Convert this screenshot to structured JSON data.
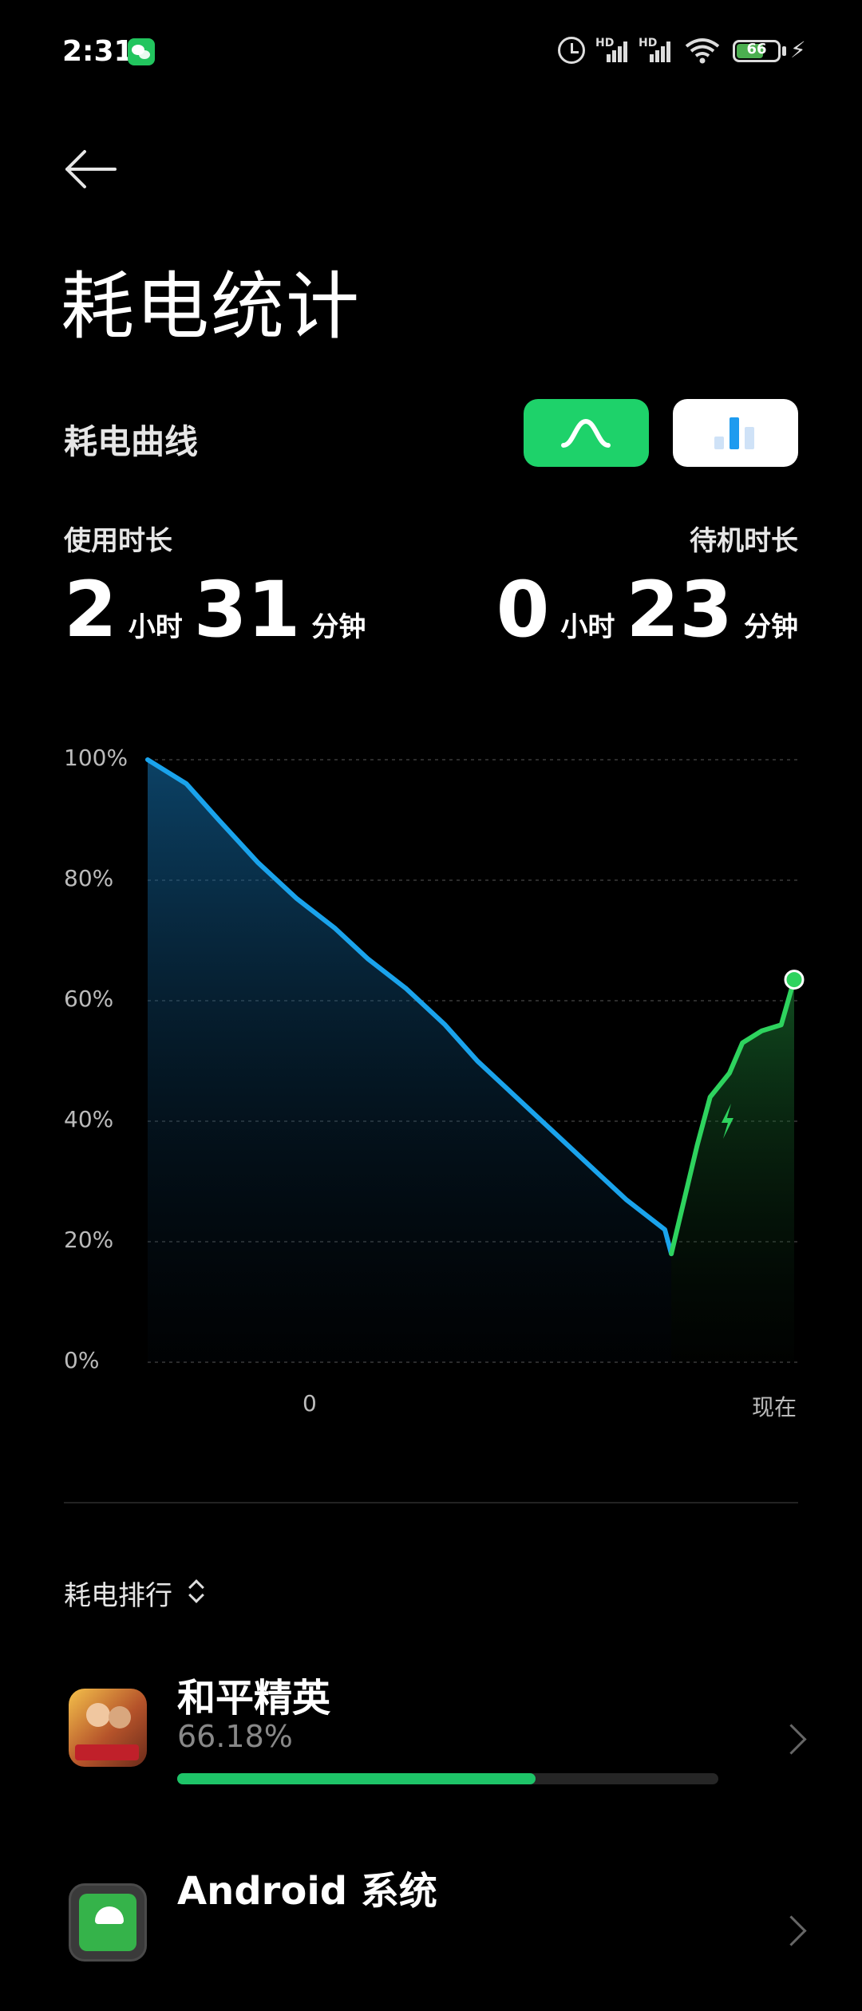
{
  "status_bar": {
    "time": "2:31",
    "battery_level": "66",
    "network": [
      "HD",
      "HD"
    ],
    "icons": [
      "wechat-icon",
      "alarm-icon",
      "signal-icon",
      "wifi-icon",
      "battery-icon",
      "charging-icon"
    ]
  },
  "header": {
    "back_icon": "arrow-left-icon",
    "title": "耗电统计"
  },
  "curve_section": {
    "title": "耗电曲线",
    "toggle_active": "curve",
    "colors": {
      "active_toggle": "#1ed26a",
      "inactive_toggle": "#ffffff"
    }
  },
  "usage": {
    "label": "使用时长",
    "hours": "2",
    "hours_unit": "小时",
    "minutes": "31",
    "minutes_unit": "分钟"
  },
  "standby": {
    "label": "待机时长",
    "hours": "0",
    "hours_unit": "小时",
    "minutes": "23",
    "minutes_unit": "分钟"
  },
  "chart_data": {
    "type": "line",
    "y_ticks": [
      "100%",
      "80%",
      "60%",
      "40%",
      "20%",
      "0%"
    ],
    "x_ticks": [
      "0",
      "现在"
    ],
    "ylim": [
      0,
      100
    ],
    "grid": true,
    "series": [
      {
        "kind": "discharge",
        "color": "#1aa3ec",
        "points": [
          [
            0,
            100
          ],
          [
            0.06,
            96
          ],
          [
            0.11,
            90
          ],
          [
            0.17,
            83
          ],
          [
            0.23,
            77
          ],
          [
            0.29,
            72
          ],
          [
            0.34,
            67
          ],
          [
            0.4,
            62
          ],
          [
            0.46,
            56
          ],
          [
            0.51,
            50
          ],
          [
            0.57,
            44
          ],
          [
            0.63,
            38
          ],
          [
            0.69,
            32
          ],
          [
            0.74,
            27
          ],
          [
            0.8,
            22
          ],
          [
            0.81,
            18
          ]
        ]
      },
      {
        "kind": "charge",
        "color": "#2ed35e",
        "points": [
          [
            0.81,
            18
          ],
          [
            0.85,
            36
          ],
          [
            0.87,
            44
          ],
          [
            0.9,
            48
          ],
          [
            0.92,
            53
          ],
          [
            0.95,
            55
          ],
          [
            0.98,
            56
          ],
          [
            1.0,
            63.5
          ]
        ]
      }
    ],
    "charging_icon": "lightning-icon"
  },
  "ranking": {
    "title": "耗电排行",
    "sort_icon": "sort-icon",
    "apps": [
      {
        "name": "和平精英",
        "percent": "66.18%",
        "share": 0.6618,
        "icon": "pubg-game-icon"
      },
      {
        "name": "Android 系统",
        "percent": "",
        "share": 0,
        "icon": "android-icon"
      }
    ]
  }
}
